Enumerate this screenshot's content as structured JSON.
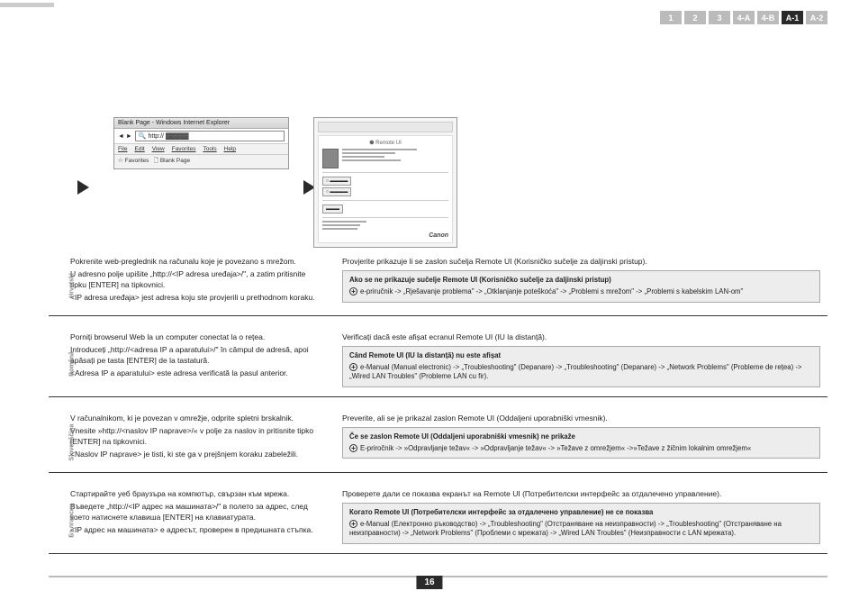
{
  "nav": [
    "1",
    "2",
    "3",
    "4-A",
    "4-B",
    "A-1",
    "A-2"
  ],
  "nav_active": 5,
  "browser": {
    "title": "Blank Page - Windows Internet Explorer",
    "addr": "http://",
    "menu": [
      "File",
      "Edit",
      "View",
      "Favorites",
      "Tools",
      "Help"
    ],
    "fav": "Favorites",
    "fav_page": "Blank Page"
  },
  "remote_ui_title": "Remote UI",
  "canon": "Canon",
  "langs": [
    {
      "label": "Hrvatski",
      "left": [
        "Pokrenite web-preglednik na računalu koje je povezano s mrežom.",
        "U adresno polje upišite „http://<IP adresa uređaja>/\", a zatim pritisnite tipku [ENTER] na tipkovnici.",
        "<IP adresa uređaja> jest adresa koju ste provjerili u prethodnom koraku."
      ],
      "right_intro": "Provjerite prikazuje li se zaslon sučelja Remote UI (Korisničko sučelje za daljinski pristup).",
      "box_title": "Ako se ne prikazuje sučelje Remote UI (Korisničko sučelje za daljinski pristup)",
      "box_body": "e-priručnik -> „Rješavanje problema\" -> „Otklanjanje poteškoća\" -> „Problemi s mrežom\" -> „Problemi s kabelskim LAN-om\""
    },
    {
      "label": "Română",
      "left": [
        "Porniți browserul Web la un computer conectat la o rețea.",
        "Introduceți „http://<adresa IP a aparatului>/\" în câmpul de adresă, apoi apăsați pe tasta [ENTER] de la tastatură.",
        "<Adresa IP a aparatului> este adresa verificată la pasul anterior."
      ],
      "right_intro": "Verificați dacă este afișat ecranul Remote UI (IU la distanță).",
      "box_title": "Când Remote UI (IU la distanță) nu este afișat",
      "box_body": "e-Manual (Manual electronic) -> „Troubleshooting\" (Depanare) -> „Troubleshooting\" (Depanare) -> „Network Problems\" (Probleme de rețea) -> „Wired LAN Troubles\" (Probleme LAN cu fir)."
    },
    {
      "label": "Slovenščina",
      "left": [
        "V računalnikom, ki je povezan v omrežje, odprite spletni brskalnik.",
        "Vnesite »http://<naslov IP naprave>/« v polje za naslov in pritisnite tipko [ENTER] na tipkovnici.",
        "<Naslov IP naprave> je tisti, ki ste ga v prejšnjem koraku zabeležili."
      ],
      "right_intro": "Preverite, ali se je prikazal zaslon Remote UI (Oddaljeni uporabniški vmesnik).",
      "box_title": "Če se zaslon Remote UI (Oddaljeni uporabniški vmesnik) ne prikaže",
      "box_body": "E-priročnik -> »Odpravljanje težav« -> »Odpravljanje težav« -> »Težave z omrežjem« ->»Težave z žičnim lokalnim omrežjem«"
    },
    {
      "label": "Български",
      "left": [
        "Стартирайте уеб браузъра на компютър, свързан към мрежа.",
        "Въведете „http://<IP адрес на машината>/\" в полето за адрес, след което натиснете клавиша [ENTER] на клавиатурата.",
        "<IP адрес на машината> е адресът, проверен в предишната стъпка."
      ],
      "right_intro": "Проверете дали се показва екранът на Remote UI (Потребителски интерфейс за отдалечено управление).",
      "box_title": "Когато Remote UI (Потребителски интерфейс за отдалечено управление) не се показва",
      "box_body": "e-Manual (Електронно ръководство) -> „Troubleshooting\" (Отстраняване на неизправности) -> „Troubleshooting\" (Отстраняване на неизправности) -> „Network Problems\" (Проблеми с мрежата) -> „Wired LAN Troubles\" (Неизправности с LAN мрежата)."
    }
  ],
  "page_number": "16"
}
